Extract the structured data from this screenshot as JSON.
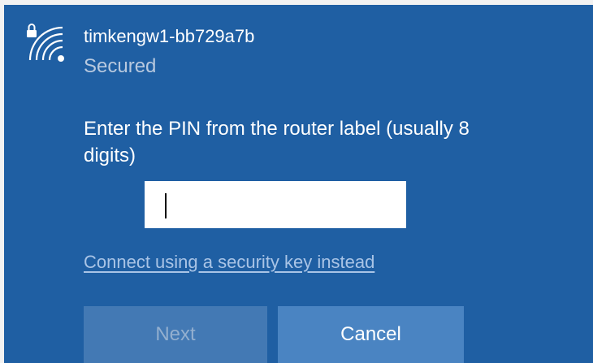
{
  "network": {
    "icon": "wifi-secured-icon",
    "ssid": "timkengw1-bb729a7b",
    "status": "Secured"
  },
  "prompt": {
    "instruction": "Enter the PIN from the router label (usually 8 digits)"
  },
  "pin_field": {
    "value": "",
    "placeholder": ""
  },
  "link": {
    "label": "Connect using a security key instead"
  },
  "buttons": {
    "next_label": "Next",
    "cancel_label": "Cancel"
  },
  "colors": {
    "panel_background": "#1f5fa3",
    "link": "#a9c4e6",
    "button_disabled": "#4379b4",
    "button": "#4a84c2"
  }
}
